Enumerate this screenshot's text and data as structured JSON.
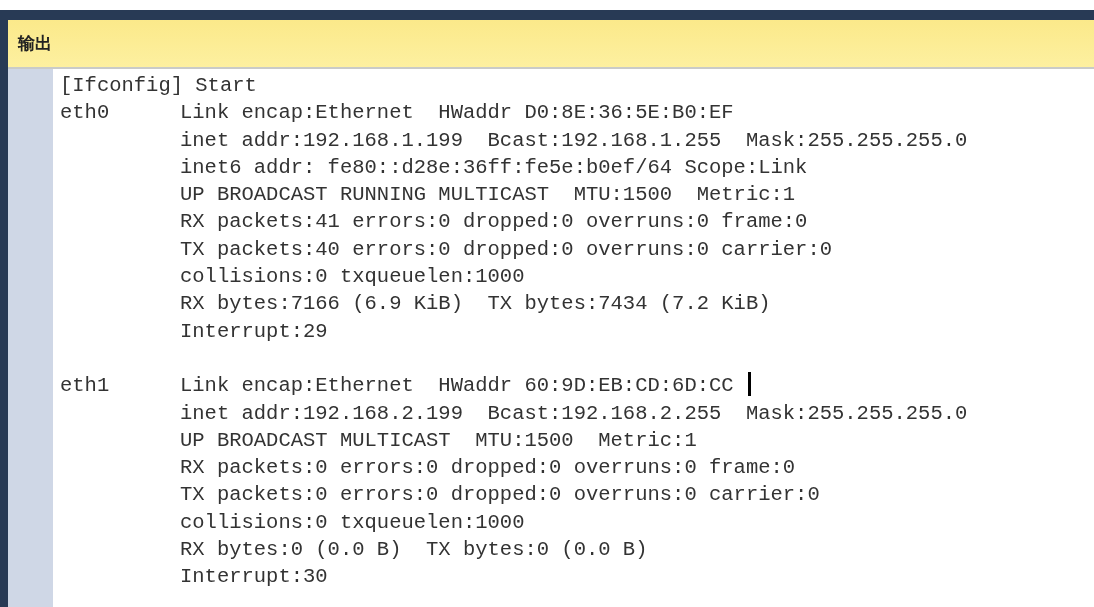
{
  "panel": {
    "title": "输出"
  },
  "output": {
    "header_line": "[Ifconfig] Start",
    "interfaces": [
      {
        "name": "eth0",
        "lines": [
          {
            "text": "Link encap:Ethernet  HWaddr D0:8E:36:5E:B0:EF",
            "cursor": false
          },
          {
            "text": "inet addr:192.168.1.199  Bcast:192.168.1.255  Mask:255.255.255.0",
            "cursor": false
          },
          {
            "text": "inet6 addr: fe80::d28e:36ff:fe5e:b0ef/64 Scope:Link",
            "cursor": false
          },
          {
            "text": "UP BROADCAST RUNNING MULTICAST  MTU:1500  Metric:1",
            "cursor": false
          },
          {
            "text": "RX packets:41 errors:0 dropped:0 overruns:0 frame:0",
            "cursor": false
          },
          {
            "text": "TX packets:40 errors:0 dropped:0 overruns:0 carrier:0",
            "cursor": false
          },
          {
            "text": "collisions:0 txqueuelen:1000",
            "cursor": false
          },
          {
            "text": "RX bytes:7166 (6.9 KiB)  TX bytes:7434 (7.2 KiB)",
            "cursor": false
          },
          {
            "text": "Interrupt:29",
            "cursor": false
          }
        ]
      },
      {
        "name": "eth1",
        "lines": [
          {
            "text": "Link encap:Ethernet  HWaddr 60:9D:EB:CD:6D:CC",
            "cursor": true
          },
          {
            "text": "inet addr:192.168.2.199  Bcast:192.168.2.255  Mask:255.255.255.0",
            "cursor": false
          },
          {
            "text": "UP BROADCAST MULTICAST  MTU:1500  Metric:1",
            "cursor": false
          },
          {
            "text": "RX packets:0 errors:0 dropped:0 overruns:0 frame:0",
            "cursor": false
          },
          {
            "text": "TX packets:0 errors:0 dropped:0 overruns:0 carrier:0",
            "cursor": false
          },
          {
            "text": "collisions:0 txqueuelen:1000",
            "cursor": false
          },
          {
            "text": "RX bytes:0 (0.0 B)  TX bytes:0 (0.0 B)",
            "cursor": false
          },
          {
            "text": "Interrupt:30",
            "cursor": false
          }
        ]
      }
    ]
  }
}
